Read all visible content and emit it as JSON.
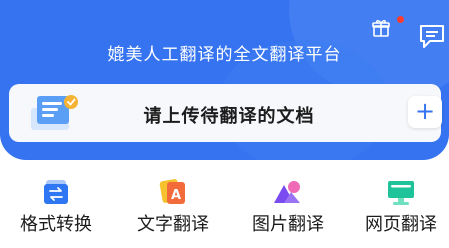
{
  "header": {
    "title": "媲美人工翻译的全文翻译平台",
    "gift_icon": "gift-icon",
    "notification_color": "#ff3b30",
    "chat_icon": "chat-icon"
  },
  "upload": {
    "label": "请上传待翻译的文档",
    "add_symbol": "+",
    "illustration_icon": "document-upload-icon"
  },
  "tools": [
    {
      "label": "格式转换",
      "icon": "format-convert-icon",
      "color": "#2f77f2"
    },
    {
      "label": "文字翻译",
      "icon": "text-translate-icon",
      "color": "#f36b3a"
    },
    {
      "label": "图片翻译",
      "icon": "image-translate-icon",
      "color": "#7a4cf0"
    },
    {
      "label": "网页翻译",
      "icon": "web-translate-icon",
      "color": "#1fc39a"
    }
  ],
  "colors": {
    "brand": "#3573f0",
    "card_bg": "#f6f8fc"
  }
}
